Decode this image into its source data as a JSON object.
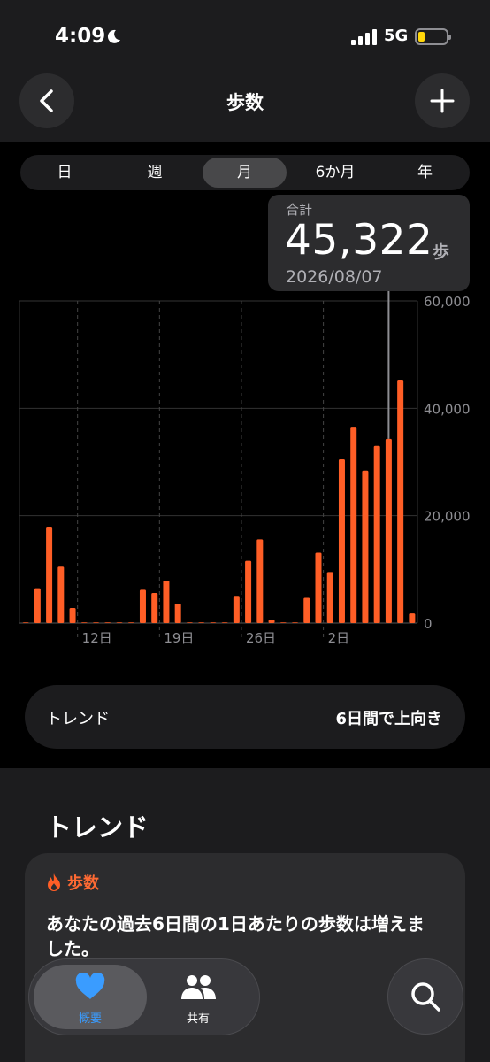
{
  "status_bar": {
    "time": "4:09",
    "network": "5G"
  },
  "header": {
    "title": "歩数"
  },
  "segments": [
    {
      "label": "日",
      "active": false
    },
    {
      "label": "週",
      "active": false
    },
    {
      "label": "月",
      "active": true
    },
    {
      "label": "6か月",
      "active": false
    },
    {
      "label": "年",
      "active": false
    }
  ],
  "tooltip": {
    "label": "合計",
    "value": "45,322",
    "unit": "歩",
    "date": "2026/08/07"
  },
  "chart_data": {
    "type": "bar",
    "y_ticks": [
      "60,000",
      "40,000",
      "20,000",
      "0"
    ],
    "ylim": [
      0,
      60000
    ],
    "x_ticks": [
      "12日",
      "19日",
      "26日",
      "2日"
    ],
    "selected_day": 31,
    "color": "#ff5e26",
    "values": [
      0,
      6500,
      17800,
      10500,
      2800,
      0,
      0,
      0,
      0,
      0,
      6200,
      5600,
      7900,
      3600,
      0,
      0,
      0,
      0,
      4900,
      11600,
      15600,
      600,
      0,
      0,
      4700,
      13100,
      9500,
      30500,
      36400,
      28400,
      33000,
      34300,
      45322,
      1800
    ]
  },
  "trend_pill": {
    "label": "トレンド",
    "value": "6日間で上向き"
  },
  "section": {
    "title": "トレンド"
  },
  "card": {
    "title": "歩数",
    "body": "あなたの過去6日間の1日あたりの歩数は増えました。"
  },
  "tabbar": {
    "summary_label": "概要",
    "sharing_label": "共有"
  },
  "colors": {
    "accent": "#ff5e26",
    "tab_active": "#3a9cff"
  }
}
